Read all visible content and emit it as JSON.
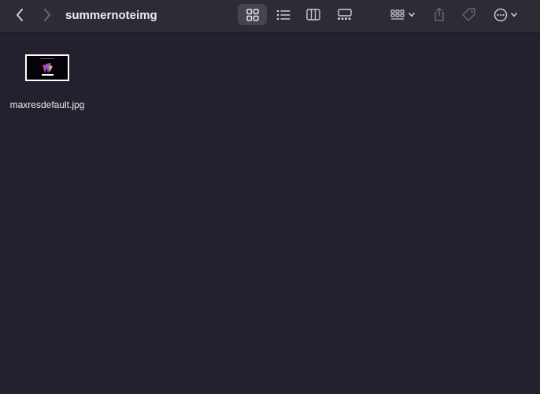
{
  "window": {
    "title": "summernoteimg"
  },
  "toolbar": {
    "back": "chevron-left-icon",
    "forward": "chevron-right-icon",
    "view_modes": [
      "icon-view",
      "list-view",
      "column-view",
      "gallery-view"
    ],
    "active_view": "icon-view",
    "group": "group-by-icon",
    "share": "share-icon",
    "tag": "tag-icon",
    "more": "more-actions-icon"
  },
  "files": [
    {
      "name": "maxresdefault.jpg",
      "kind": "image-thumbnail"
    }
  ],
  "colors": {
    "background": "#25202e",
    "toolbar": "#2f2b35",
    "text": "#ececee",
    "icon": "#cfcdd2",
    "icon_disabled": "#6d6974"
  }
}
